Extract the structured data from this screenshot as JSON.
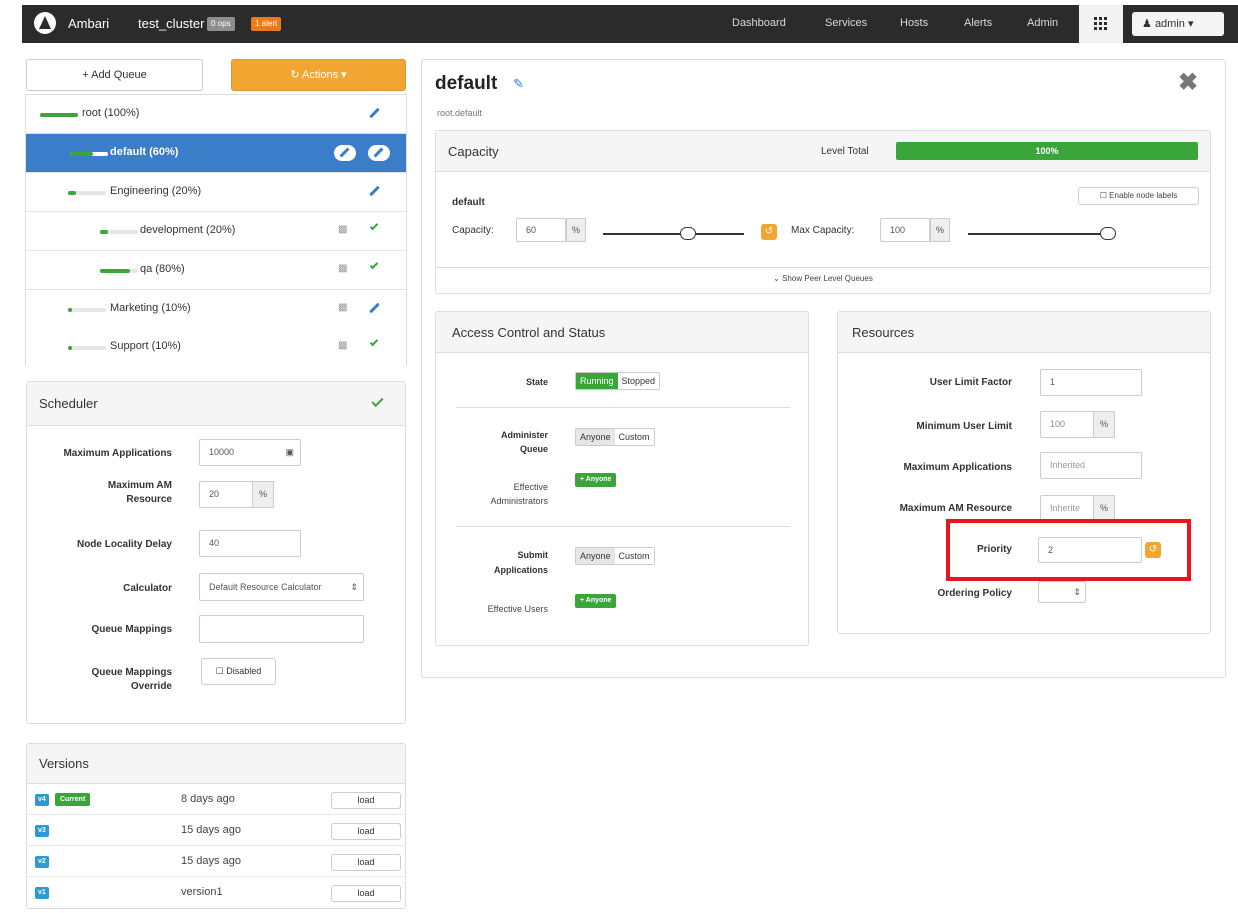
{
  "navbar": {
    "brand": "Ambari",
    "cluster": "test_cluster",
    "ops_badge": "0 ops",
    "alerts_badge": "1 alert",
    "links": [
      "Dashboard",
      "Services",
      "Hosts",
      "Alerts",
      "Admin"
    ],
    "user": "admin"
  },
  "sidebar": {
    "add_queue": "+ Add Queue",
    "actions": "Actions",
    "queues": [
      {
        "label": "root (100%)",
        "fill": 1.0
      },
      {
        "label": "default (60%)",
        "fill": 0.6,
        "selected": true
      },
      {
        "label": "Engineering (20%)",
        "fill": 0.2
      },
      {
        "label": "development (20%)",
        "fill": 0.2
      },
      {
        "label": "qa (80%)",
        "fill": 0.8
      },
      {
        "label": "Marketing (10%)",
        "fill": 0.1
      },
      {
        "label": "Support (10%)",
        "fill": 0.1
      }
    ]
  },
  "scheduler": {
    "title": "Scheduler",
    "max_apps_label": "Maximum Applications",
    "max_apps_value": "10000",
    "max_am_label_1": "Maximum AM",
    "max_am_label_2": "Resource",
    "max_am_value": "20",
    "percent": "%",
    "node_locality_label": "Node Locality Delay",
    "node_locality_value": "40",
    "calculator_label": "Calculator",
    "calculator_value": "Default Resource Calculator",
    "queue_mappings_label": "Queue Mappings",
    "override_label_1": "Queue Mappings",
    "override_label_2": "Override",
    "override_value": "Disabled"
  },
  "versions": {
    "title": "Versions",
    "current_label": "Current",
    "load_label": "load",
    "rows": [
      {
        "tag": "v4",
        "when": "8 days ago",
        "current": true
      },
      {
        "tag": "v3",
        "when": "15 days ago"
      },
      {
        "tag": "v2",
        "when": "15 days ago"
      },
      {
        "tag": "v1",
        "when": "version1"
      }
    ]
  },
  "main": {
    "title": "default",
    "path": "root.default",
    "capacity": {
      "title": "Capacity",
      "level_total_label": "Level Total",
      "level_total_value": "100%",
      "level_total_fill": 1.0,
      "queue_name": "default",
      "enable_node_labels": "Enable node labels",
      "capacity_label": "Capacity:",
      "capacity_value": "60",
      "capacity_slider_level": 0.6,
      "max_capacity_label": "Max Capacity:",
      "max_capacity_value": "100",
      "max_capacity_slider_level": 1.0,
      "percent": "%",
      "show_peer": "Show Peer Level Queues"
    },
    "access": {
      "title": "Access Control and Status",
      "state_label": "State",
      "running": "Running",
      "stopped": "Stopped",
      "administer_label_1": "Administer",
      "administer_label_2": "Queue",
      "anyone": "Anyone",
      "custom": "Custom",
      "effective_admins_1": "Effective",
      "effective_admins_2": "Administrators",
      "anyone_badge": "Anyone",
      "submit_label_1": "Submit",
      "submit_label_2": "Applications",
      "effective_users": "Effective Users"
    },
    "resources": {
      "title": "Resources",
      "user_limit_factor_label": "User Limit Factor",
      "user_limit_factor_value": "1",
      "min_user_limit_label": "Minimum User Limit",
      "min_user_limit_value": "100",
      "max_apps_label": "Maximum Applications",
      "max_apps_placeholder": "Inherited",
      "max_am_label": "Maximum AM Resource",
      "max_am_placeholder": "Inherite",
      "percent": "%",
      "priority_label": "Priority",
      "priority_value": "2",
      "ordering_policy_label": "Ordering Policy"
    }
  },
  "colors": {
    "navbar": "#2b2b2b",
    "selected_row": "#3a7dc9",
    "green": "#3aa63a",
    "orange": "#f0a630",
    "highlight": "#e8161c"
  }
}
